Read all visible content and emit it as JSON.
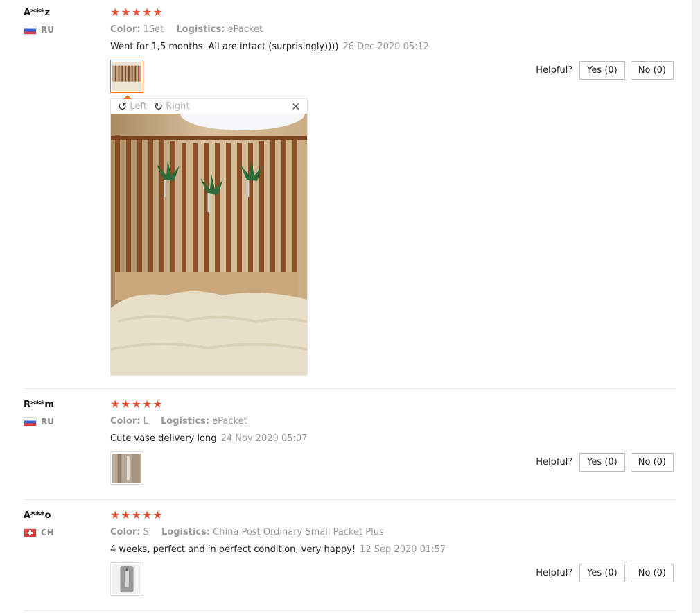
{
  "reviews": [
    {
      "user": "A***z",
      "country": "RU",
      "stars": "★★★★★",
      "color_label": "Color:",
      "color_value": "1Set",
      "logistics_label": "Logistics:",
      "logistics_value": "ePacket",
      "text": "Went for 1,5 months. All are intact (surprisingly))))",
      "date": "26 Dec 2020 05:12",
      "helpful_label": "Helpful?",
      "yes_label": "Yes (0)",
      "no_label": "No (0)"
    },
    {
      "user": "R***m",
      "country": "RU",
      "stars": "★★★★★",
      "color_label": "Color:",
      "color_value": "L",
      "logistics_label": "Logistics:",
      "logistics_value": "ePacket",
      "text": "Cute vase delivery long",
      "date": "24 Nov 2020 05:07",
      "helpful_label": "Helpful?",
      "yes_label": "Yes (0)",
      "no_label": "No (0)"
    },
    {
      "user": "A***o",
      "country": "CH",
      "stars": "★★★★★",
      "color_label": "Color:",
      "color_value": "S",
      "logistics_label": "Logistics:",
      "logistics_value": "China Post Ordinary Small Packet Plus",
      "text": "4 weeks, perfect and in perfect condition, very happy!",
      "date": "12 Sep 2020 01:57",
      "helpful_label": "Helpful?",
      "yes_label": "Yes (0)",
      "no_label": "No (0)"
    }
  ],
  "viewer": {
    "rotate_left_label": "Left",
    "rotate_right_label": "Right",
    "close_glyph": "✕"
  },
  "colors": {
    "star": "#f2553c",
    "active_thumb": "#f57224"
  }
}
